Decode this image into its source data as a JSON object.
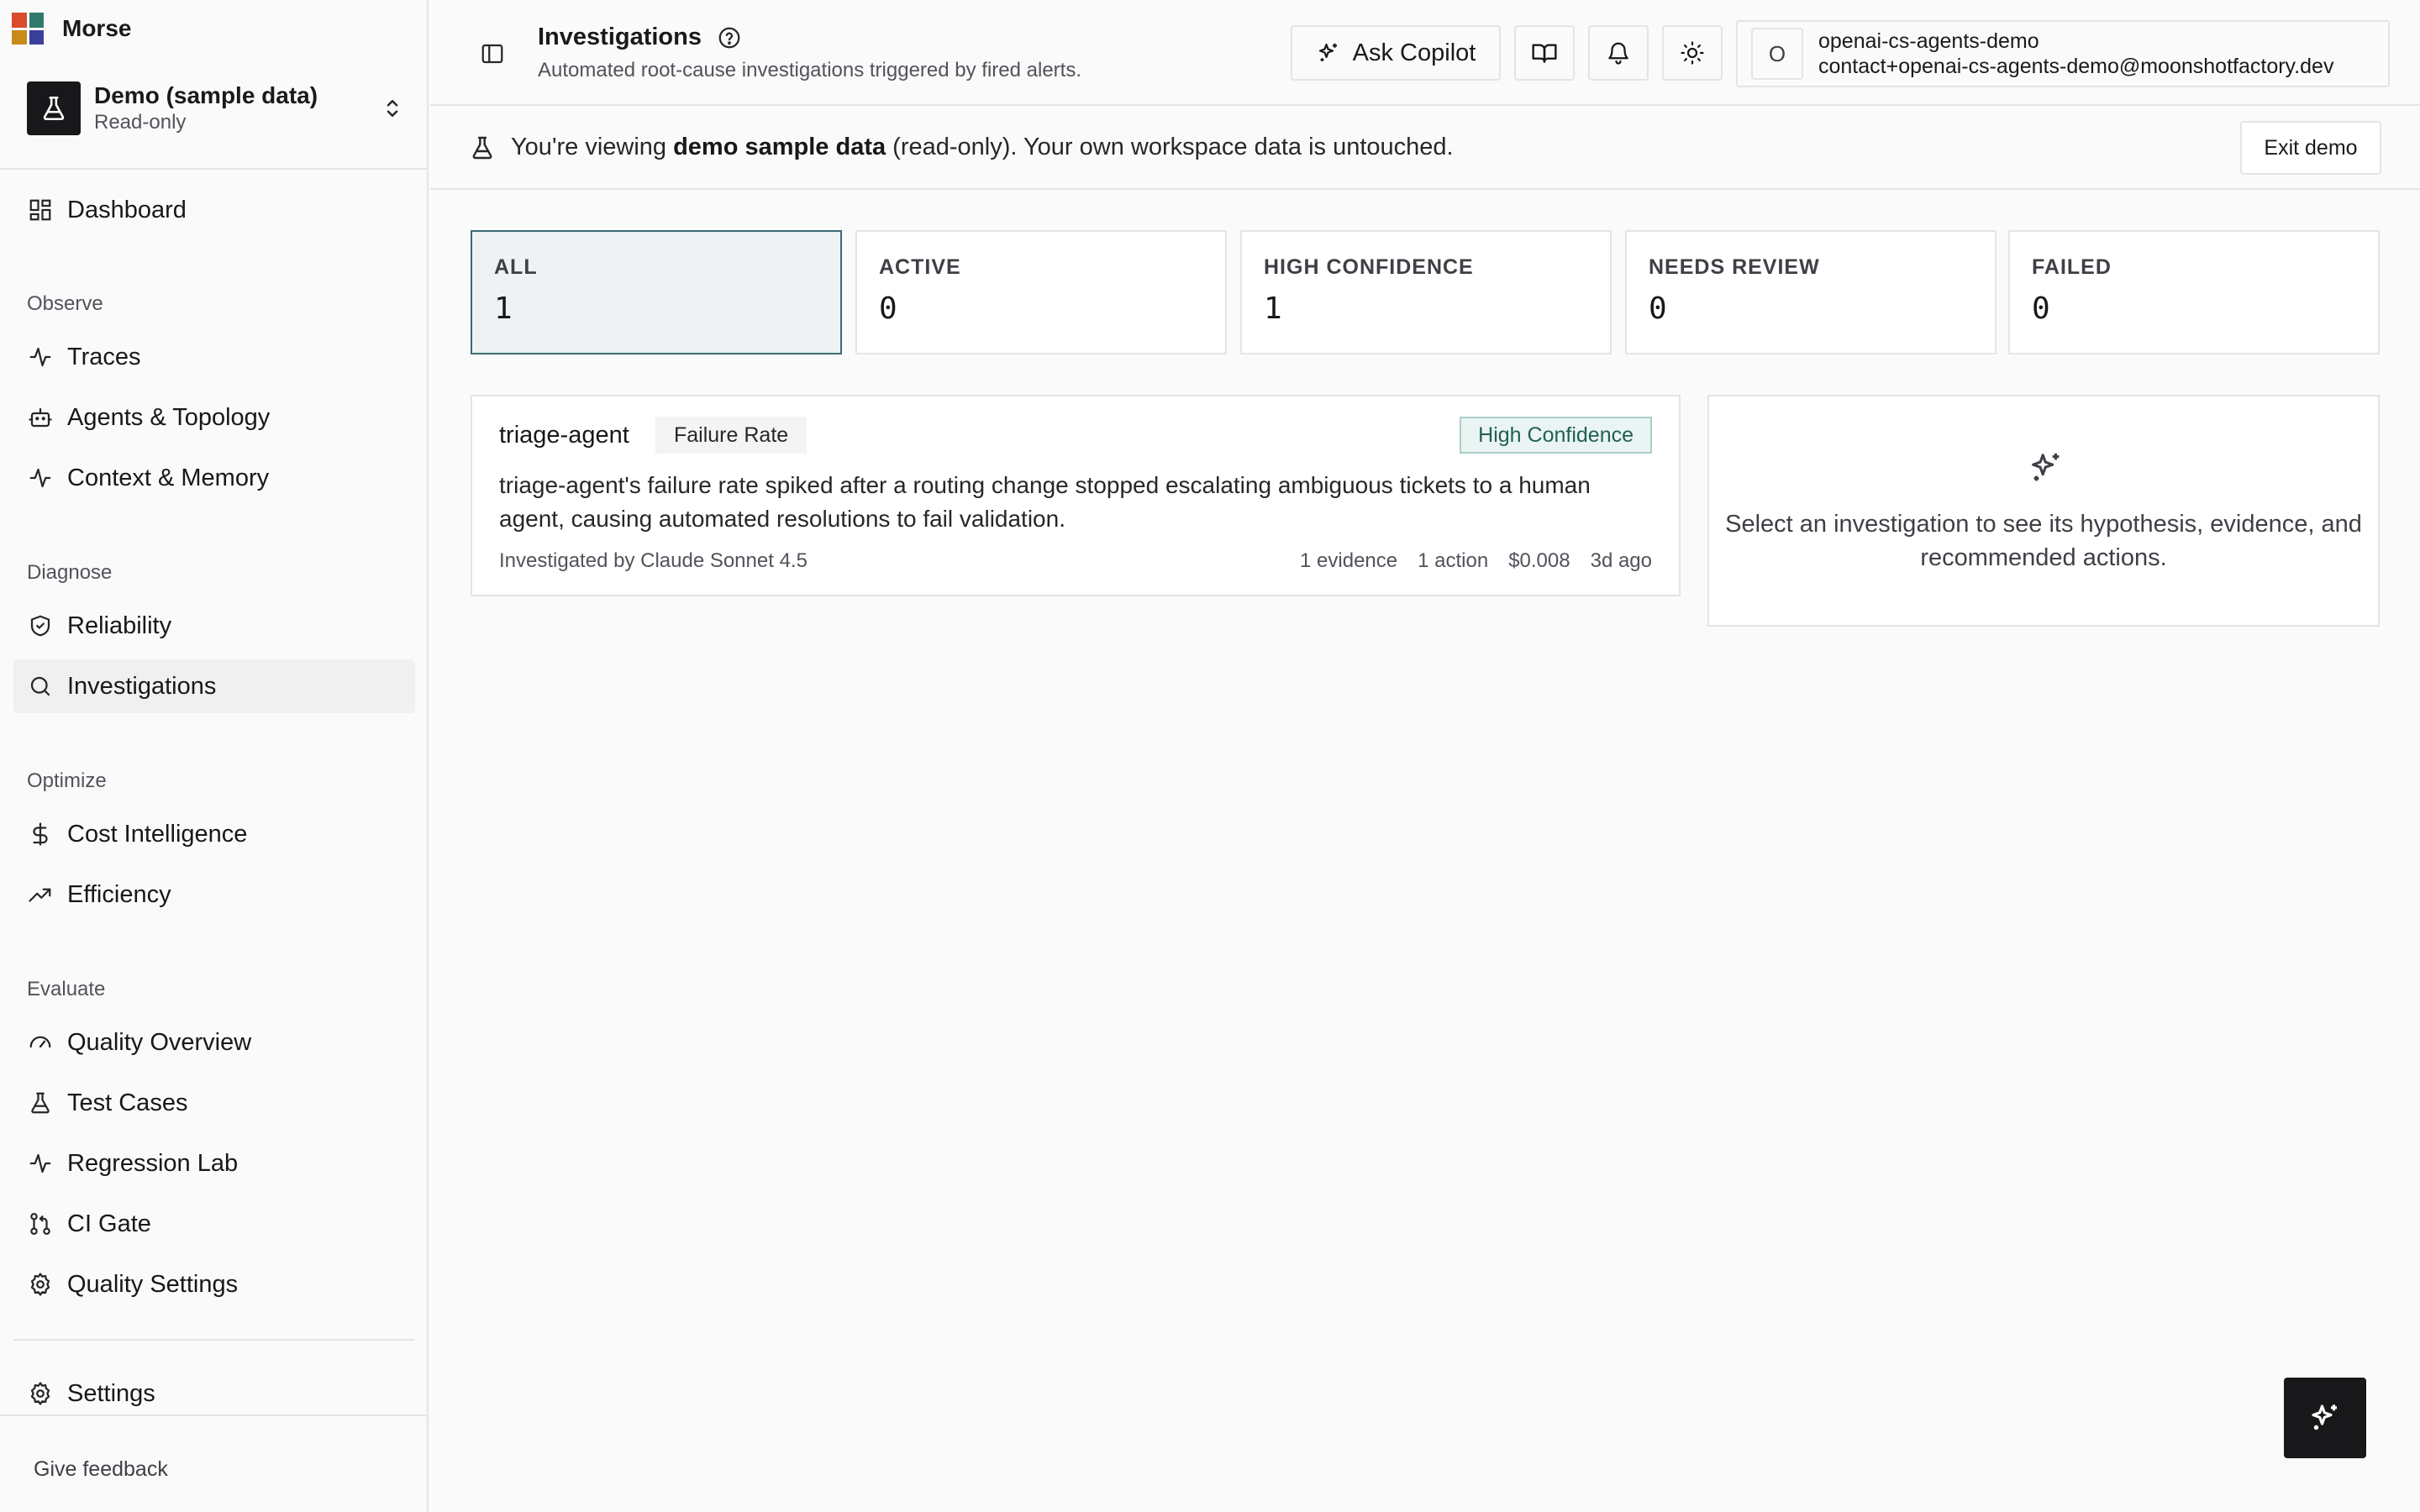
{
  "app": {
    "name": "Morse",
    "logo_colors": [
      "#d94b2b",
      "#2f7a6a",
      "#c98a1c",
      "#3a3f9a"
    ]
  },
  "workspace": {
    "name": "Demo (sample data)",
    "mode": "Read-only"
  },
  "sidebar": {
    "dashboard": "Dashboard",
    "sections": {
      "observe": "Observe",
      "diagnose": "Diagnose",
      "optimize": "Optimize",
      "evaluate": "Evaluate"
    },
    "items": {
      "traces": "Traces",
      "agents": "Agents & Topology",
      "context": "Context & Memory",
      "reliability": "Reliability",
      "investigations": "Investigations",
      "cost": "Cost Intelligence",
      "efficiency": "Efficiency",
      "quality_overview": "Quality Overview",
      "test_cases": "Test Cases",
      "regression_lab": "Regression Lab",
      "ci_gate": "CI Gate",
      "quality_settings": "Quality Settings",
      "settings": "Settings"
    },
    "active": "investigations",
    "feedback": "Give feedback"
  },
  "header": {
    "title": "Investigations",
    "subtitle": "Automated root-cause investigations triggered by fired alerts.",
    "copilot_label": "Ask Copilot",
    "account": {
      "avatar": "O",
      "name": "openai-cs-agents-demo",
      "email": "contact+openai-cs-agents-demo@moonshotfactory.dev"
    }
  },
  "banner": {
    "prefix": "You're viewing ",
    "bold": "demo sample data",
    "suffix": " (read-only). Your own workspace data is untouched.",
    "exit_label": "Exit demo"
  },
  "stats": [
    {
      "label": "ALL",
      "value": "1"
    },
    {
      "label": "ACTIVE",
      "value": "0"
    },
    {
      "label": "HIGH CONFIDENCE",
      "value": "1"
    },
    {
      "label": "NEEDS REVIEW",
      "value": "0"
    },
    {
      "label": "FAILED",
      "value": "0"
    }
  ],
  "investigation": {
    "agent": "triage-agent",
    "tag": "Failure Rate",
    "confidence": "High Confidence",
    "description": "triage-agent's failure rate spiked after a routing change stopped escalating ambiguous tickets to a human agent, causing automated resolutions to fail validation.",
    "investigated_by": "Investigated by Claude Sonnet 4.5",
    "evidence": "1 evidence",
    "actions": "1 action",
    "cost": "$0.008",
    "age": "3d ago"
  },
  "detail": {
    "placeholder": "Select an investigation to see its hypothesis, evidence, and recommended actions."
  },
  "colors": {
    "accent": "#3d6b72",
    "confidence_bg": "#eaf4f2",
    "confidence_text": "#1f5f55"
  }
}
